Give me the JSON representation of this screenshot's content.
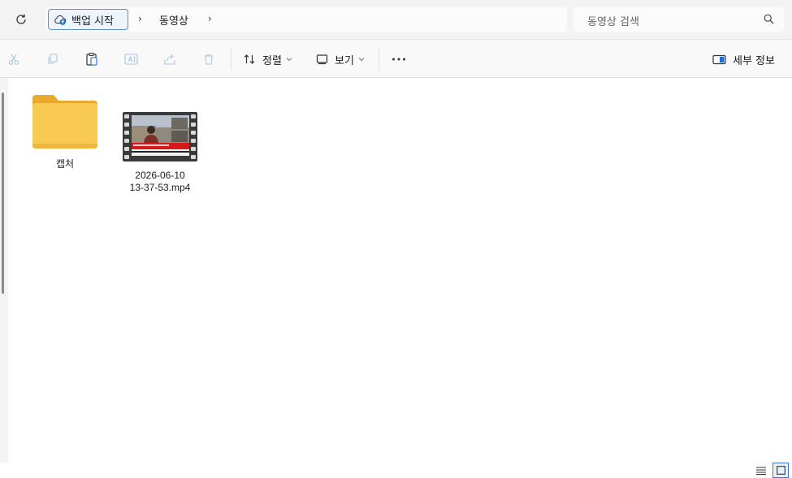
{
  "address": {
    "backup_label": "백업 시작",
    "crumbs": [
      "동영상"
    ]
  },
  "search": {
    "placeholder": "동영상 검색"
  },
  "toolbar": {
    "sort_label": "정렬",
    "view_label": "보기",
    "details_label": "세부 정보"
  },
  "items": [
    {
      "type": "folder",
      "name": "캡처"
    },
    {
      "type": "video",
      "name_line1": "2026-06-10",
      "name_line2": "13-37-53.mp4"
    }
  ],
  "colors": {
    "accent": "#3b78d6",
    "folder": "#f7c64b"
  }
}
